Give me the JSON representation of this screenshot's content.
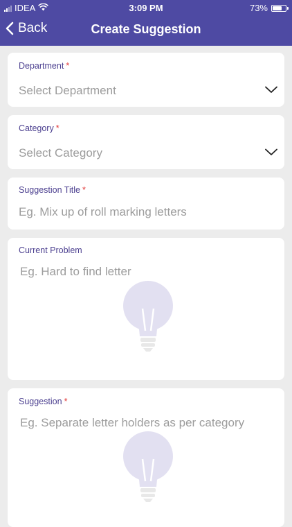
{
  "status_bar": {
    "carrier": "IDEA",
    "time": "3:09 PM",
    "battery": "73%",
    "battery_level": 0.73
  },
  "nav": {
    "back_label": "Back",
    "title": "Create Suggestion"
  },
  "form": {
    "department": {
      "label": "Department",
      "required_mark": "*",
      "placeholder": "Select Department"
    },
    "category": {
      "label": "Category",
      "required_mark": "*",
      "placeholder": "Select Category"
    },
    "title": {
      "label": "Suggestion Title",
      "required_mark": "*",
      "placeholder": "Eg. Mix up of roll marking letters"
    },
    "current_problem": {
      "label": "Current Problem",
      "placeholder": "Eg. Hard to find letter"
    },
    "suggestion": {
      "label": "Suggestion",
      "required_mark": "*",
      "placeholder": "Eg. Separate letter holders as per category"
    }
  },
  "icons": {
    "back": "chevron-left-icon",
    "dropdown": "chevron-down-icon",
    "bulb": "lightbulb-icon"
  },
  "colors": {
    "header": "#4E4AA3",
    "label": "#4B3F8F",
    "required": "#E23B3B",
    "placeholder": "#9C9C9C",
    "background": "#ECECEC"
  }
}
